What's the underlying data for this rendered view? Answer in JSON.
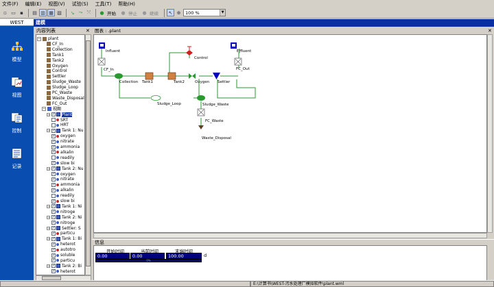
{
  "menubar": [
    {
      "label": "文件(F)",
      "name": "menu-file"
    },
    {
      "label": "编辑(E)",
      "name": "menu-edit"
    },
    {
      "label": "视图(V)",
      "name": "menu-view"
    },
    {
      "label": "试验(S)",
      "name": "menu-experiment"
    },
    {
      "label": "工具(T)",
      "name": "menu-tools"
    },
    {
      "label": "帮助(H)",
      "name": "menu-help"
    }
  ],
  "toolbar": {
    "start_label": "开始",
    "stop_label": "停止",
    "continue_label": "继续",
    "zoom_value": "100 %"
  },
  "leftbar": {
    "title": "WEST",
    "items": [
      {
        "label": "模型",
        "icon": "model-icon"
      },
      {
        "label": "视图",
        "icon": "view-icon"
      },
      {
        "label": "控制",
        "icon": "control-icon"
      },
      {
        "label": "记录",
        "icon": "record-icon"
      }
    ]
  },
  "module_title": "建模",
  "tree": {
    "title": "内容列表",
    "rows": [
      {
        "text": "plant",
        "ind": 0,
        "ck": "",
        "kind": "root"
      },
      {
        "text": "CF_In",
        "ind": 2,
        "ck": "",
        "kind": "unit"
      },
      {
        "text": "Collection",
        "ind": 2,
        "ck": "",
        "kind": "unit"
      },
      {
        "text": "Tank1",
        "ind": 2,
        "ck": "",
        "kind": "unit"
      },
      {
        "text": "Tank2",
        "ind": 2,
        "ck": "",
        "kind": "unit"
      },
      {
        "text": "Oxygen",
        "ind": 2,
        "ck": "",
        "kind": "unit"
      },
      {
        "text": "Control",
        "ind": 2,
        "ck": "",
        "kind": "unit"
      },
      {
        "text": "Settler",
        "ind": 2,
        "ck": "",
        "kind": "unit"
      },
      {
        "text": "Sludge_Waste",
        "ind": 2,
        "ck": "",
        "kind": "unit"
      },
      {
        "text": "Sludge_Loop",
        "ind": 2,
        "ck": "",
        "kind": "unit"
      },
      {
        "text": "PC_Waste",
        "ind": 2,
        "ck": "",
        "kind": "unit"
      },
      {
        "text": "Waste_Disposal",
        "ind": 2,
        "ck": "",
        "kind": "unit"
      },
      {
        "text": "FC_Out",
        "ind": 2,
        "ck": "",
        "kind": "unit"
      },
      {
        "text": "视图",
        "ind": 1,
        "ck": "",
        "kind": "folder"
      },
      {
        "text": "Plant",
        "ind": 2,
        "ck": "x",
        "kind": "sel"
      },
      {
        "text": "SRT",
        "ind": 3,
        "ck": "",
        "kind": "var"
      },
      {
        "text": "HRT",
        "ind": 3,
        "ck": "",
        "kind": "var"
      },
      {
        "text": "Tank 1: Nu",
        "ind": 2,
        "ck": "x",
        "kind": "group"
      },
      {
        "text": "oxygen",
        "ind": 3,
        "ck": "x",
        "kind": "var"
      },
      {
        "text": "nitrate",
        "ind": 3,
        "ck": "x",
        "kind": "var"
      },
      {
        "text": "ammonia",
        "ind": 3,
        "ck": "x",
        "kind": "var"
      },
      {
        "text": "alkalin",
        "ind": 3,
        "ck": "x",
        "kind": "var"
      },
      {
        "text": "readily",
        "ind": 3,
        "ck": "",
        "kind": "var"
      },
      {
        "text": "slow bi",
        "ind": 3,
        "ck": "x",
        "kind": "var"
      },
      {
        "text": "Tank 2: Nu",
        "ind": 2,
        "ck": "x",
        "kind": "group"
      },
      {
        "text": "oxygen",
        "ind": 3,
        "ck": "x",
        "kind": "var"
      },
      {
        "text": "nitrate",
        "ind": 3,
        "ck": "x",
        "kind": "var"
      },
      {
        "text": "ammonia",
        "ind": 3,
        "ck": "x",
        "kind": "var"
      },
      {
        "text": "alkalin",
        "ind": 3,
        "ck": "x",
        "kind": "var"
      },
      {
        "text": "readily",
        "ind": 3,
        "ck": "",
        "kind": "var"
      },
      {
        "text": "slow bi",
        "ind": 3,
        "ck": "x",
        "kind": "var"
      },
      {
        "text": "Tank 1: Ni",
        "ind": 2,
        "ck": "x",
        "kind": "group"
      },
      {
        "text": "nitroge",
        "ind": 3,
        "ck": "x",
        "kind": "var"
      },
      {
        "text": "Tank 2: Ni",
        "ind": 2,
        "ck": "x",
        "kind": "group"
      },
      {
        "text": "nitroge",
        "ind": 3,
        "ck": "x",
        "kind": "var"
      },
      {
        "text": "Settler: S",
        "ind": 2,
        "ck": "x",
        "kind": "group"
      },
      {
        "text": "particu",
        "ind": 3,
        "ck": "x",
        "kind": "var"
      },
      {
        "text": "Tank 1: Bi",
        "ind": 2,
        "ck": "x",
        "kind": "group"
      },
      {
        "text": "heterot",
        "ind": 3,
        "ck": "x",
        "kind": "var"
      },
      {
        "text": "autotro",
        "ind": 3,
        "ck": "x",
        "kind": "var"
      },
      {
        "text": "soluble",
        "ind": 3,
        "ck": "x",
        "kind": "var"
      },
      {
        "text": "particu",
        "ind": 3,
        "ck": "x",
        "kind": "var"
      },
      {
        "text": "Tank 2: Bi",
        "ind": 2,
        "ck": "x",
        "kind": "group"
      },
      {
        "text": "heterot",
        "ind": 3,
        "ck": "x",
        "kind": "var"
      }
    ]
  },
  "diagram": {
    "header": "图表 : .plant",
    "labels": {
      "influent": "Influent",
      "cf_in": "CF_In",
      "collection": "Collection",
      "tank1": "Tank1",
      "tank2": "Tank2",
      "oxygen": "Oxygen",
      "control": "Control",
      "settler": "Settler",
      "effluent": "Effluent",
      "fc_out": "FC_Out",
      "sludge_loop": "Sludge_Loop",
      "sludge_waste": "Sludge_Waste",
      "fc_waste": "FC_Waste",
      "waste_disposal": "Waste_Disposal"
    }
  },
  "info": {
    "title": "信息",
    "start_header": "开始时间",
    "current_header": "当前时间",
    "end_header": "末端时间",
    "start_value": "0.00",
    "current_value": "0.00",
    "end_value": "100.00",
    "unit": "d",
    "progress_text": "0%",
    "progress": 0
  },
  "status": {
    "path": "E:\\计算书\\WEST-污水处理厂模拟软件\\plant.wml"
  },
  "colors": {
    "titlebar": "#0a30a0",
    "sidebar": "#0a4db0",
    "pipe": "#2a9a30",
    "valve": "#d02020"
  }
}
